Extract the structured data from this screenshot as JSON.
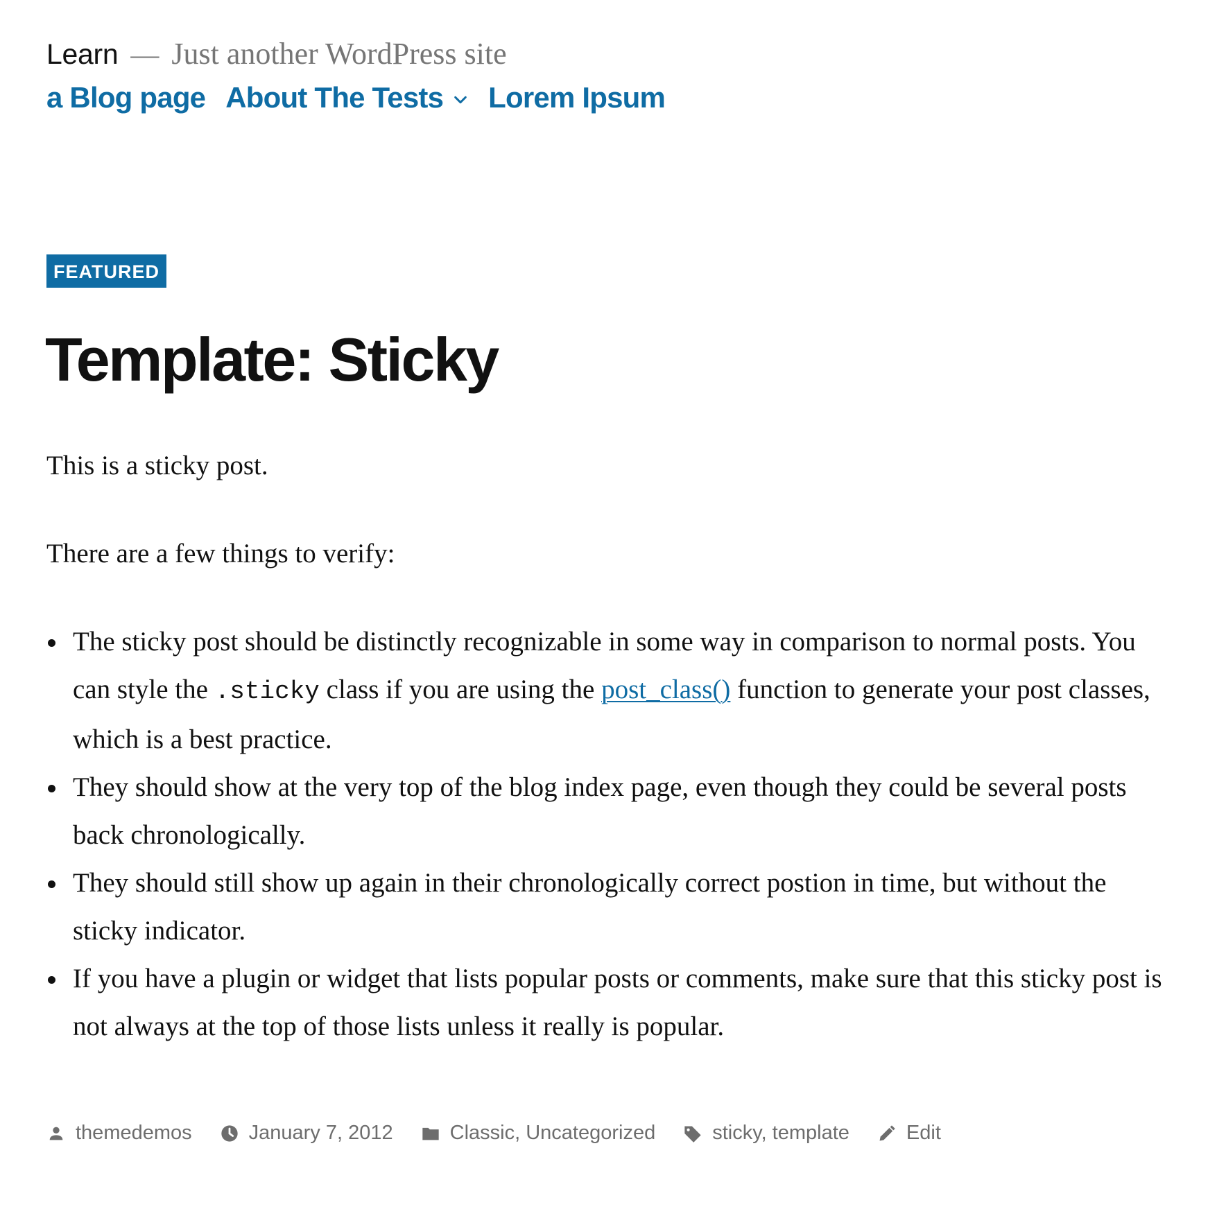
{
  "header": {
    "site_title": "Learn",
    "separator": "—",
    "site_description": "Just another WordPress site",
    "menu": [
      {
        "label": "a Blog page"
      },
      {
        "label": "About The Tests",
        "has_submenu": true
      },
      {
        "label": "Lorem Ipsum"
      }
    ]
  },
  "post": {
    "badge": "FEATURED",
    "title": "Template: Sticky",
    "paragraphs": [
      "This is a sticky post.",
      "There are a few things to verify:"
    ],
    "list": {
      "item1_text_a": "The sticky post should be distinctly recognizable in some way in comparison to normal posts. You can style the ",
      "item1_code": ".sticky",
      "item1_text_b": " class if you are using the ",
      "item1_link": "post_class()",
      "item1_text_c": " function to generate your post classes, which is a best practice.",
      "item2": "They should show at the very top of the blog index page, even though they could be several posts back chronologically.",
      "item3": "They should still show up again in their chronologically correct postion in time, but without the sticky indicator.",
      "item4": "If you have a plugin or widget that lists popular posts or comments, make sure that this sticky post is not always at the top of those lists unless it really is popular."
    },
    "meta": {
      "author": "themedemos",
      "date": "January 7, 2012",
      "categories": "Classic, Uncategorized",
      "tags": "sticky, template",
      "edit": "Edit"
    }
  },
  "colors": {
    "accent": "#0f6ca4",
    "text": "#111111",
    "muted": "#6d6d6d"
  },
  "icons": {
    "author": "person-icon",
    "date": "clock-icon",
    "categories": "folder-icon",
    "tags": "tag-icon",
    "edit": "pencil-icon",
    "submenu": "chevron-down-icon"
  }
}
